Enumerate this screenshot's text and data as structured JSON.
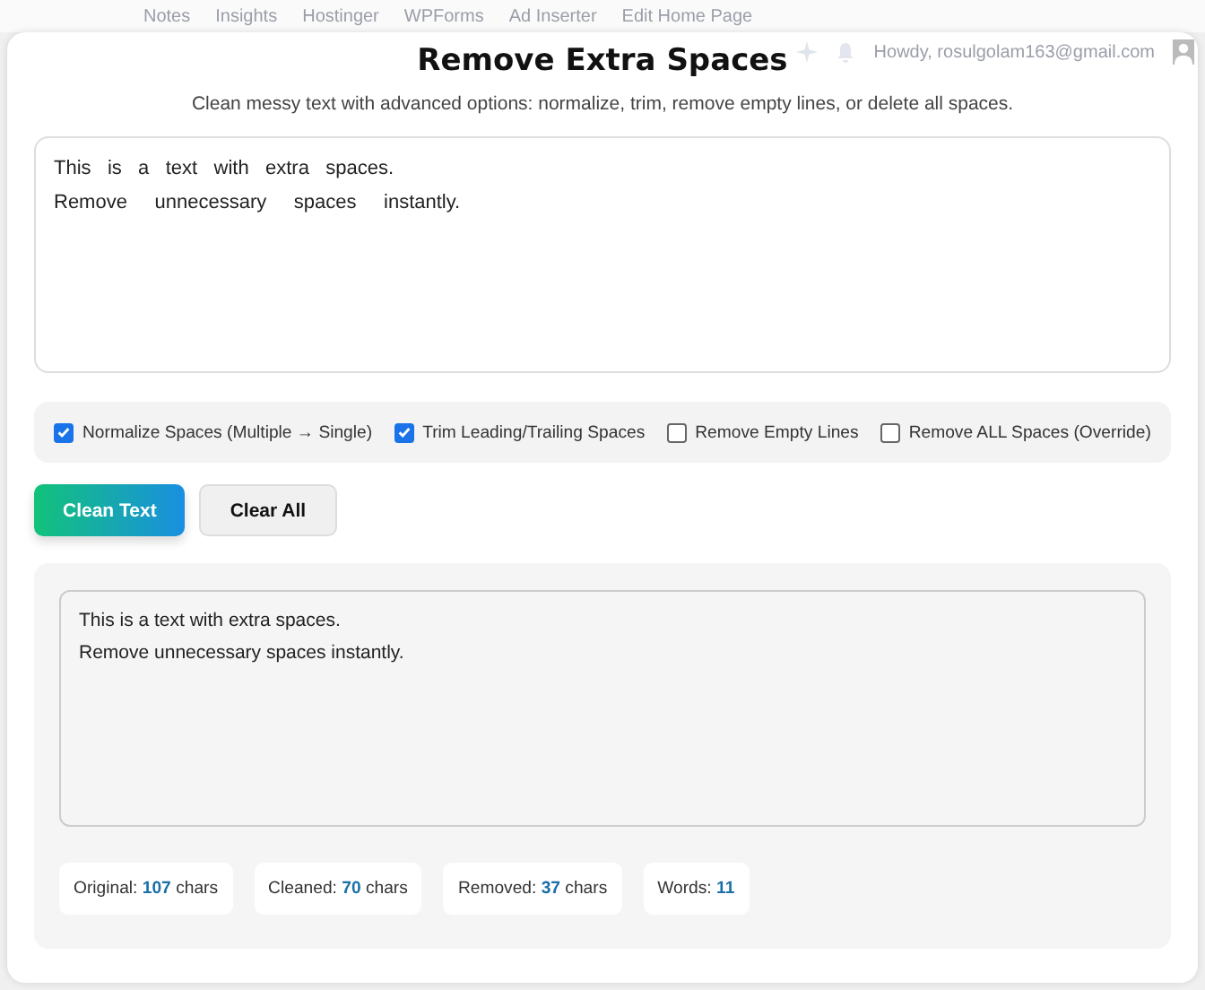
{
  "admin_bar": {
    "items": [
      "Notes",
      "Insights",
      "Hostinger",
      "WPForms",
      "Ad Inserter",
      "Edit Home Page"
    ],
    "greeting": "Howdy, rosulgolam163@gmail.com"
  },
  "title": "Remove Extra Spaces",
  "subtitle": "Clean messy text with advanced options: normalize, trim, remove empty lines, or delete all spaces.",
  "input": {
    "value": "This   is   a   text   with   extra   spaces.\nRemove     unnecessary     spaces     instantly."
  },
  "options": [
    {
      "label": "Normalize Spaces (Multiple → Single)",
      "checked": true
    },
    {
      "label": "Trim Leading/Trailing Spaces",
      "checked": true
    },
    {
      "label": "Remove Empty Lines",
      "checked": false
    },
    {
      "label": "Remove ALL Spaces (Override)",
      "checked": false
    }
  ],
  "buttons": [
    {
      "label": "Clean Text",
      "kind": "primary"
    },
    {
      "label": "Clear All",
      "kind": "secondary"
    }
  ],
  "output": {
    "value": "This is a text with extra spaces.\nRemove unnecessary spaces instantly."
  },
  "stats": [
    {
      "label": "Original:",
      "value": "107",
      "unit": "chars"
    },
    {
      "label": "Cleaned:",
      "value": "70",
      "unit": "chars"
    },
    {
      "label": "Removed:",
      "value": "37",
      "unit": "chars"
    },
    {
      "label": "Words:",
      "value": "11"
    }
  ]
}
